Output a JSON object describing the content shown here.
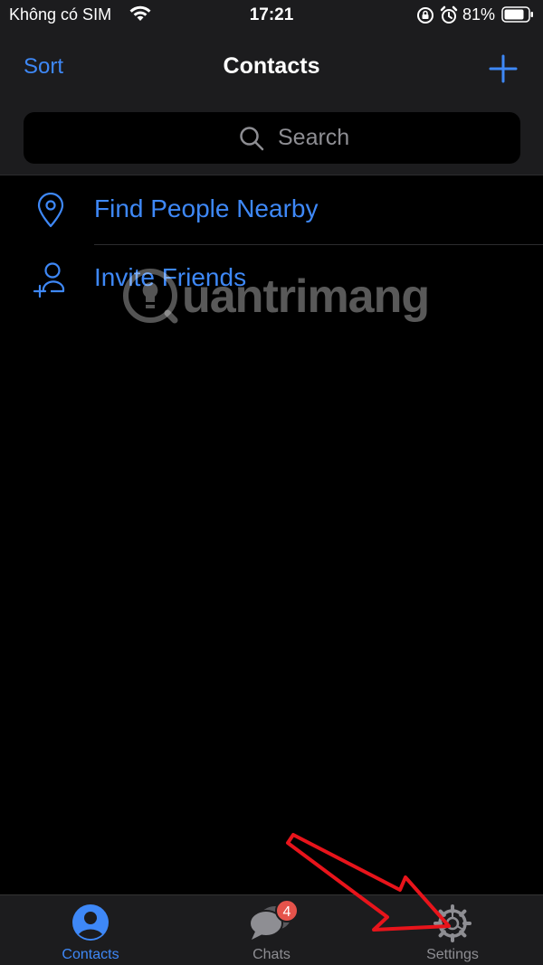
{
  "status_bar": {
    "carrier": "Không có SIM",
    "time": "17:21",
    "battery": "81%"
  },
  "header": {
    "sort_label": "Sort",
    "title": "Contacts",
    "add_icon": "plus-icon",
    "search_placeholder": "Search"
  },
  "list": {
    "items": [
      {
        "label": "Find People Nearby",
        "icon": "location-pin-icon"
      },
      {
        "label": "Invite Friends",
        "icon": "add-person-icon"
      }
    ]
  },
  "watermark": {
    "text": "uantrimang"
  },
  "tabs": [
    {
      "label": "Contacts",
      "icon": "person-icon",
      "active": true
    },
    {
      "label": "Chats",
      "icon": "chat-bubbles-icon",
      "badge": "4"
    },
    {
      "label": "Settings",
      "icon": "gear-icon"
    }
  ],
  "colors": {
    "accent": "#3e88f7",
    "badge": "#e5534b",
    "annotation_arrow": "#e8141b"
  }
}
